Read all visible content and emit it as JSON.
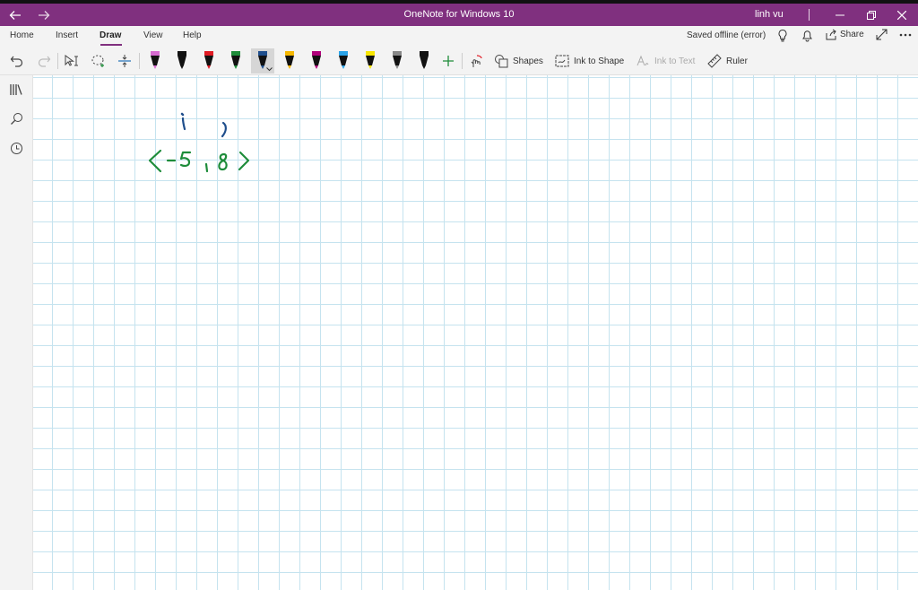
{
  "window": {
    "title": "OneNote for Windows 10",
    "user": "linh vu",
    "back_icon": "arrow-left-icon",
    "forward_icon": "arrow-right-icon"
  },
  "tabs": [
    {
      "label": "Home"
    },
    {
      "label": "Insert"
    },
    {
      "label": "Draw",
      "active": true
    },
    {
      "label": "View"
    },
    {
      "label": "Help"
    }
  ],
  "status": {
    "sync": "Saved offline (error)",
    "share": "Share"
  },
  "toolbar": {
    "shapes": "Shapes",
    "ink_to_shape": "Ink to Shape",
    "ink_to_text": "Ink to Text",
    "ruler": "Ruler",
    "pens": [
      {
        "color": "#d66bd0"
      },
      {
        "color": "#111111"
      },
      {
        "color": "#e01b24"
      },
      {
        "color": "#1e8c3a"
      },
      {
        "color": "#1f4e8c",
        "selected": true
      },
      {
        "color": "#f5b700"
      },
      {
        "color": "#b0007a"
      },
      {
        "color": "#2aa3e8"
      },
      {
        "color": "#f7e500"
      },
      {
        "color": "#888888"
      },
      {
        "color": "#111111"
      }
    ]
  },
  "colors": {
    "accent": "#80307f",
    "ink_green": "#1e8c3a",
    "ink_blue": "#1f4e8c"
  }
}
